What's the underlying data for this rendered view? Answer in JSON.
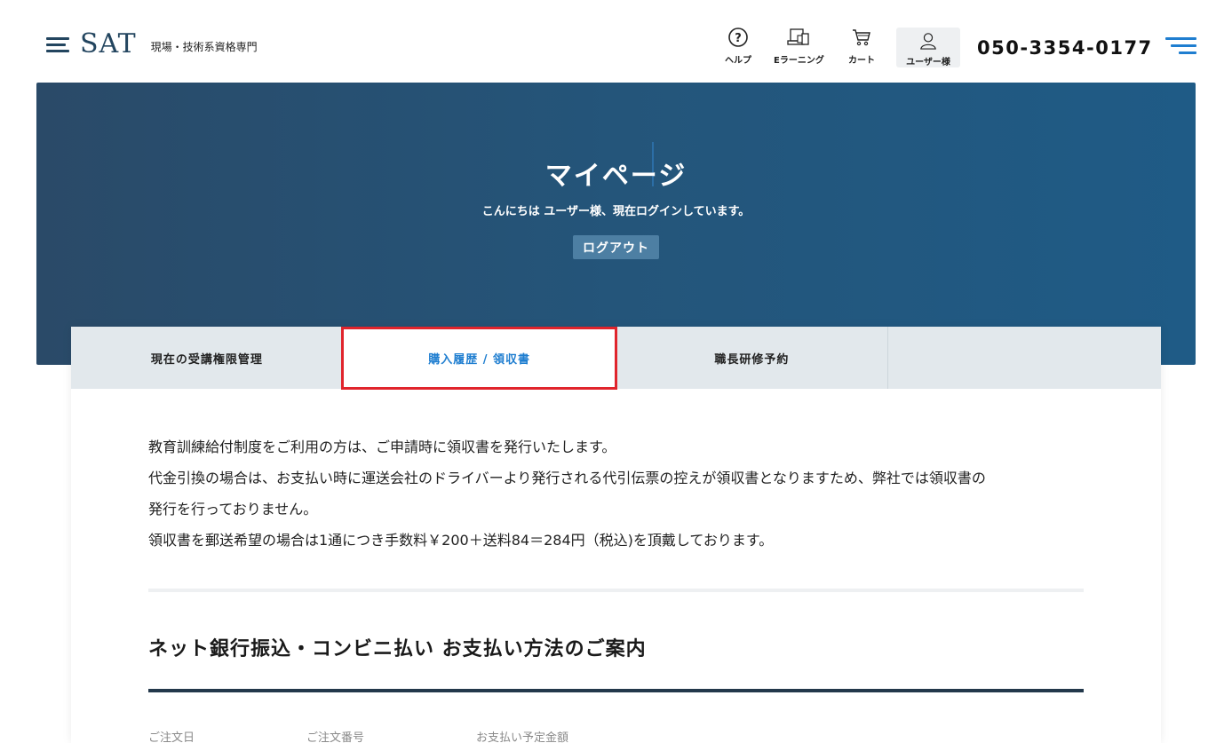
{
  "header": {
    "logo_text": "SAT",
    "logo_sub": "現場・技術系資格専門",
    "nav": {
      "help": "ヘルプ",
      "elearning": "Eラーニング",
      "cart": "カート",
      "user": "ユーザー様"
    },
    "phone": "050-3354-0177",
    "icons": [
      "hamburger-logo-icon",
      "help-icon",
      "devices-icon",
      "cart-icon",
      "user-icon",
      "menu-icon"
    ]
  },
  "hero": {
    "title": "マイページ",
    "greeting": "こんにちは ユーザー様、現在ログインしています。",
    "logout_label": "ログアウト"
  },
  "tabs": [
    {
      "label": "現在の受講権限管理",
      "active": false
    },
    {
      "label": "購入履歴 / 領収書",
      "active": true
    },
    {
      "label": "職長研修予約",
      "active": false
    },
    {
      "label": "",
      "active": false
    }
  ],
  "notice": {
    "line1": "教育訓練給付制度をご利用の方は、ご申請時に領収書を発行いたします。",
    "line2": "代金引換の場合は、お支払い時に運送会社のドライバーより発行される代引伝票の控えが領収書となりますため、弊社では領収書の",
    "line3": "発行を行っておりません。",
    "line4": "領収書を郵送希望の場合は1通につき手数料￥200＋送料84＝284円（税込)を頂戴しております。"
  },
  "section": {
    "title": "ネット銀行振込・コンビニ払い お支払い方法のご案内",
    "columns": [
      "ご注文日",
      "ご注文番号",
      "お支払い予定金額"
    ]
  },
  "colors": {
    "accent": "#1f7ed0",
    "hero_bg": "#24557a",
    "highlight": "#e0242c",
    "logout_bg": "#4d7fa3"
  }
}
